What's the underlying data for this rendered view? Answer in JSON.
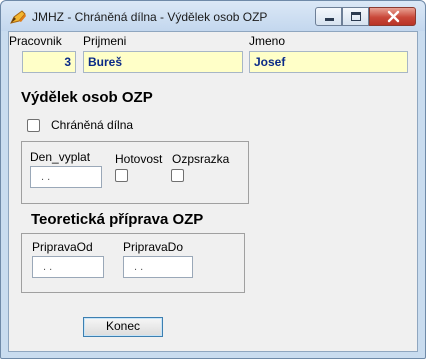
{
  "window": {
    "title": "JMHZ - Chráněná dílna - Výdělek osob OZP"
  },
  "header": {
    "labels": {
      "pracovnik": "Pracovnik",
      "prijmeni": "Prijmeni",
      "jmeno": "Jmeno"
    },
    "values": {
      "pracovnik": "3",
      "prijmeni": "Bureš",
      "jmeno": "Josef"
    }
  },
  "section1": {
    "title": "Výdělek osob OZP",
    "checkbox_label": "Chráněná dílna",
    "den_vyplat_label": "Den_vyplat",
    "den_vyplat_value": ". .",
    "hotovost_label": "Hotovost",
    "ozpsrazka_label": "Ozpsrazka"
  },
  "section2": {
    "title": "Teoretická příprava OZP",
    "priprava_od_label": "PripravaOd",
    "priprava_od_value": ". .",
    "priprava_do_label": "PripravaDo",
    "priprava_do_value": ". ."
  },
  "buttons": {
    "konec": "Konec"
  },
  "icons": {
    "app": "pen-icon",
    "minimize": "minimize-icon",
    "maximize": "maximize-icon",
    "close": "close-icon"
  },
  "colors": {
    "field_bg": "#ffffc8",
    "field_text": "#0a2a87",
    "close_btn": "#c9483a"
  }
}
